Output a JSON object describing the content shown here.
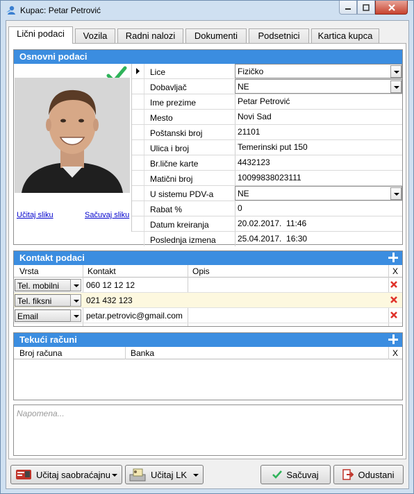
{
  "window": {
    "title": "Kupac: Petar Petrović"
  },
  "tabs": [
    {
      "label": "Lični podaci",
      "active": true
    },
    {
      "label": "Vozila"
    },
    {
      "label": "Radni nalozi"
    },
    {
      "label": "Dokumenti"
    },
    {
      "label": "Podsetnici"
    },
    {
      "label": "Kartica kupca"
    }
  ],
  "basic": {
    "header": "Osnovni podaci",
    "load_photo": "Učitaj sliku",
    "save_photo": "Sačuvaj sliku",
    "fields": [
      {
        "label": "Lice",
        "value": "Fizičko",
        "dropdown": true
      },
      {
        "label": "Dobavljač",
        "value": "NE",
        "dropdown": true
      },
      {
        "label": "Ime prezime",
        "value": "Petar Petrović"
      },
      {
        "label": "Mesto",
        "value": "Novi Sad"
      },
      {
        "label": "Poštanski broj",
        "value": "21101"
      },
      {
        "label": "Ulica i broj",
        "value": "Temerinski put 150"
      },
      {
        "label": "Br.lične karte",
        "value": "4432123"
      },
      {
        "label": "Matični broj",
        "value": "10099838023111"
      },
      {
        "label": "U sistemu PDV-a",
        "value": "NE",
        "dropdown": true
      },
      {
        "label": "Rabat %",
        "value": "0"
      },
      {
        "label": "Datum kreiranja",
        "value": "20.02.2017.  11:46"
      },
      {
        "label": "Poslednja izmena",
        "value": "25.04.2017.  16:30"
      }
    ]
  },
  "contacts": {
    "header": "Kontakt podaci",
    "columns": {
      "type": "Vrsta",
      "contact": "Kontakt",
      "desc": "Opis",
      "x": "X"
    },
    "rows": [
      {
        "type": "Tel. mobilni",
        "contact": "060 12 12 12"
      },
      {
        "type": "Tel. fiksni",
        "contact": "021 432 123"
      },
      {
        "type": "Email",
        "contact": "petar.petrovic@gmail.com"
      }
    ]
  },
  "accounts": {
    "header": "Tekući računi",
    "columns": {
      "number": "Broj računa",
      "bank": "Banka",
      "x": "X"
    }
  },
  "note": {
    "placeholder": "Napomena..."
  },
  "buttons": {
    "load_registration": "Učitaj saobraćajnu",
    "load_id": "Učitaj LK",
    "save": "Sačuvaj",
    "cancel": "Odustani"
  },
  "colors": {
    "accent": "#3b8de0",
    "highlight_row": "#fdf8df",
    "delete": "#e0332b",
    "check": "#2fb35a"
  }
}
